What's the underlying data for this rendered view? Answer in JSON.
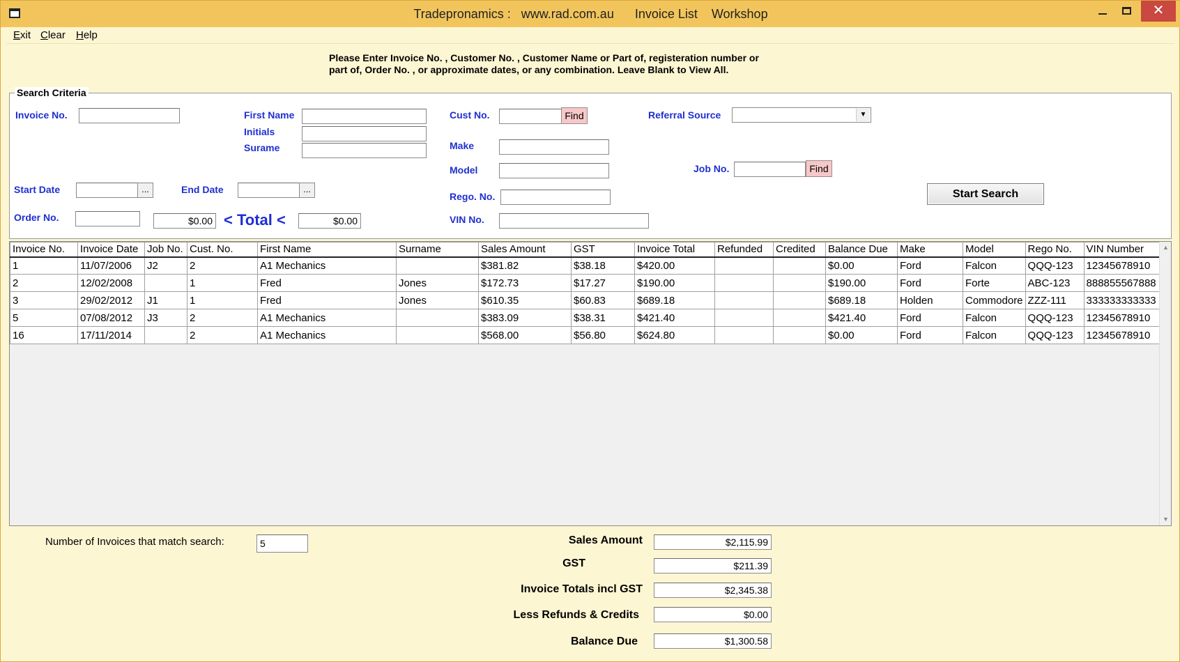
{
  "window": {
    "title": "Tradepronamics :   www.rad.com.au      Invoice List    Workshop",
    "close_glyph": "✕"
  },
  "menu": [
    {
      "key": "E",
      "rest": "xit"
    },
    {
      "key": "C",
      "rest": "lear"
    },
    {
      "key": "H",
      "rest": "elp"
    }
  ],
  "instructions": {
    "line1": "Please Enter Invoice No. , Customer No. , Customer Name or Part of, registeration number or",
    "line2": "part of, Order No. , or approximate dates, or any combination. Leave Blank to View All."
  },
  "search": {
    "group_title": "Search Criteria",
    "invoice_no_label": "Invoice No.",
    "first_name_label": "First Name",
    "initials_label": "Initials",
    "surname_label": "Surame",
    "cust_no_label": "Cust No.",
    "find_label": "Find",
    "referral_label": "Referral Source",
    "make_label": "Make",
    "model_label": "Model",
    "job_no_label": "Job No.",
    "start_date_label": "Start Date",
    "end_date_label": "End Date",
    "ellipsis": "...",
    "rego_label": "Rego. No.",
    "order_no_label": "Order No.",
    "total_min": "$0.00",
    "total_label": "< Total <",
    "total_max": "$0.00",
    "vin_label": "VIN  No.",
    "start_search": "Start Search"
  },
  "table": {
    "columns": [
      "Invoice No.",
      "Invoice Date",
      "Job No.",
      "Cust. No.",
      "First Name",
      "Surname",
      "Sales Amount",
      "GST",
      "Invoice Total",
      "Refunded",
      "Credited",
      "Balance Due",
      "Make",
      "Model",
      "Rego No.",
      "VIN Number"
    ],
    "rows": [
      [
        "1",
        "11/07/2006",
        "J2",
        "2",
        "A1 Mechanics",
        "",
        "$381.82",
        "$38.18",
        "$420.00",
        "",
        "",
        "$0.00",
        "Ford",
        "Falcon",
        "QQQ-123",
        "12345678910"
      ],
      [
        "2",
        "12/02/2008",
        "",
        "1",
        "Fred",
        "Jones",
        "$172.73",
        "$17.27",
        "$190.00",
        "",
        "",
        "$190.00",
        "Ford",
        "Forte",
        "ABC-123",
        "888855567888"
      ],
      [
        "3",
        "29/02/2012",
        "J1",
        "1",
        "Fred",
        "Jones",
        "$610.35",
        "$60.83",
        "$689.18",
        "",
        "",
        "$689.18",
        "Holden",
        "Commodore",
        "ZZZ-111",
        "333333333333"
      ],
      [
        "5",
        "07/08/2012",
        "J3",
        "2",
        "A1 Mechanics",
        "",
        "$383.09",
        "$38.31",
        "$421.40",
        "",
        "",
        "$421.40",
        "Ford",
        "Falcon",
        "QQQ-123",
        "12345678910"
      ],
      [
        "16",
        "17/11/2014",
        "",
        "2",
        "A1 Mechanics",
        "",
        "$568.00",
        "$56.80",
        "$624.80",
        "",
        "",
        "$0.00",
        "Ford",
        "Falcon",
        "QQQ-123",
        "12345678910"
      ]
    ]
  },
  "summary": {
    "count_label": "Number of Invoices that match search:",
    "count_value": "5",
    "sales_amount_label": "Sales Amount",
    "sales_amount": "$2,115.99",
    "gst_label": "GST",
    "gst": "$211.39",
    "invoice_totals_label": "Invoice Totals incl GST",
    "invoice_totals": "$2,345.38",
    "refunds_label": "Less Refunds & Credits",
    "refunds": "$0.00",
    "balance_label": "Balance Due",
    "balance": "$1,300.58"
  }
}
